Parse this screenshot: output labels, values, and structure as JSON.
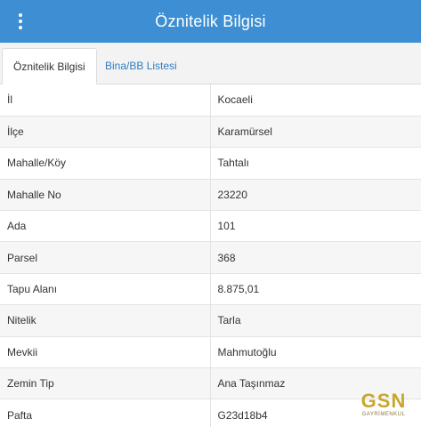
{
  "header": {
    "title": "Öznitelik Bilgisi",
    "menu_icon": "vertical-dots-icon"
  },
  "tabs": [
    {
      "label": "Öznitelik Bilgisi",
      "active": true
    },
    {
      "label": "Bina/BB Listesi",
      "active": false
    }
  ],
  "attributes": [
    {
      "key": "İl",
      "value": "Kocaeli"
    },
    {
      "key": "İlçe",
      "value": "Karamürsel"
    },
    {
      "key": "Mahalle/Köy",
      "value": "Tahtalı"
    },
    {
      "key": "Mahalle No",
      "value": "23220"
    },
    {
      "key": "Ada",
      "value": "101"
    },
    {
      "key": "Parsel",
      "value": "368"
    },
    {
      "key": "Tapu Alanı",
      "value": "8.875,01"
    },
    {
      "key": "Nitelik",
      "value": "Tarla"
    },
    {
      "key": "Mevkii",
      "value": "Mahmutoğlu"
    },
    {
      "key": "Zemin Tip",
      "value": "Ana Taşınmaz"
    },
    {
      "key": "Pafta",
      "value": "G23d18b4"
    }
  ],
  "watermark": {
    "logo": "GSN",
    "subtitle": "GAYRİMENKUL"
  },
  "colors": {
    "header_bg": "#3d8ed3",
    "tab_link": "#2f7dc2",
    "watermark_gold": "#c9a72e"
  }
}
